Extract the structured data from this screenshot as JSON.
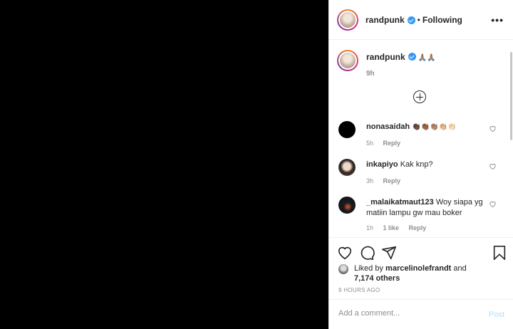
{
  "post": {
    "username": "randpunk",
    "separator": "•",
    "follow_state": "Following",
    "more_icon": "•••"
  },
  "caption": {
    "username": "randpunk",
    "emoji": "🙏🏽🙏🏽",
    "time": "9h"
  },
  "comments": [
    {
      "username": "nonasaidah",
      "text": "👏🏿👏🏾👏🏽👏🏼👏🏻",
      "time": "5h",
      "likes": "",
      "reply": "Reply",
      "avatar_color": "#000000"
    },
    {
      "username": "inkapiyo",
      "text": "Kak knp?",
      "time": "3h",
      "likes": "",
      "reply": "Reply",
      "avatar_color": "#5a4a44"
    },
    {
      "username": "_malaikatmaut123",
      "text": "Woy siapa yg matiin lampu gw mau boker",
      "time": "1h",
      "likes": "1 like",
      "reply": "Reply",
      "avatar_color": "#1a1a22"
    }
  ],
  "likes": {
    "prefix": "Liked by",
    "user": "marcelinolefrandt",
    "and": "and",
    "others": "7,174 others"
  },
  "timestamp": "9 HOURS AGO",
  "add_comment": {
    "placeholder": "Add a comment...",
    "post_label": "Post"
  },
  "colors": {
    "accent": "#3897f0",
    "post_disabled": "#b2dffc",
    "muted": "#8e8e8e",
    "media_bg": "#000000"
  }
}
